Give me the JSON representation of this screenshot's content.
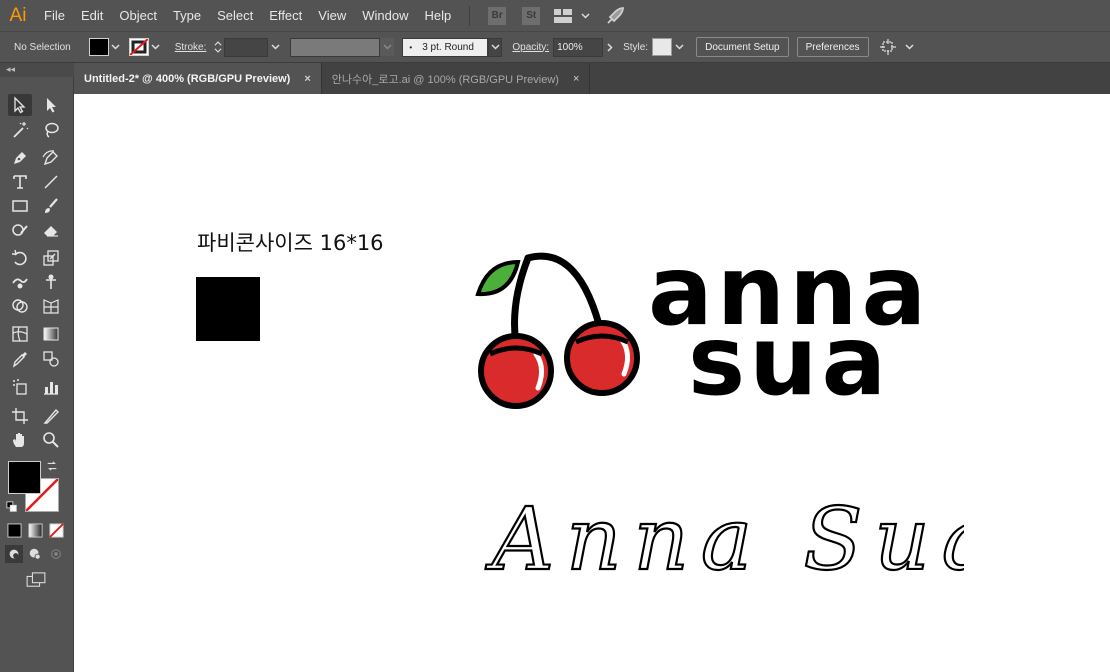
{
  "app": {
    "logo_text": "Ai"
  },
  "menu": [
    "File",
    "Edit",
    "Object",
    "Type",
    "Select",
    "Effect",
    "View",
    "Window",
    "Help"
  ],
  "menubar_badges": {
    "bridge": "Br",
    "stock": "St"
  },
  "control_bar": {
    "selection_label": "No Selection",
    "stroke_label": "Stroke:",
    "brush_label": "3 pt. Round",
    "opacity_label": "Opacity:",
    "opacity_value": "100%",
    "style_label": "Style:",
    "document_setup": "Document Setup",
    "preferences": "Preferences"
  },
  "tabs": [
    {
      "label": "Untitled-2* @ 400% (RGB/GPU Preview)",
      "active": true
    },
    {
      "label": "안나수아_로고.ai @ 100% (RGB/GPU Preview)",
      "active": false
    }
  ],
  "tab_close_glyph": "×",
  "canvas": {
    "favicon_label": "파비콘사이즈 16*16",
    "logo_text_top": "anna",
    "logo_text_bottom": "sua",
    "script_text": "Anna Sua"
  },
  "colors": {
    "ui_bg": "#535353",
    "cherry_red": "#d92b2b",
    "leaf_green": "#4caf3a",
    "ink": "#000000",
    "fill_swatch": "#000000",
    "stroke_none": "#e01b1b"
  }
}
